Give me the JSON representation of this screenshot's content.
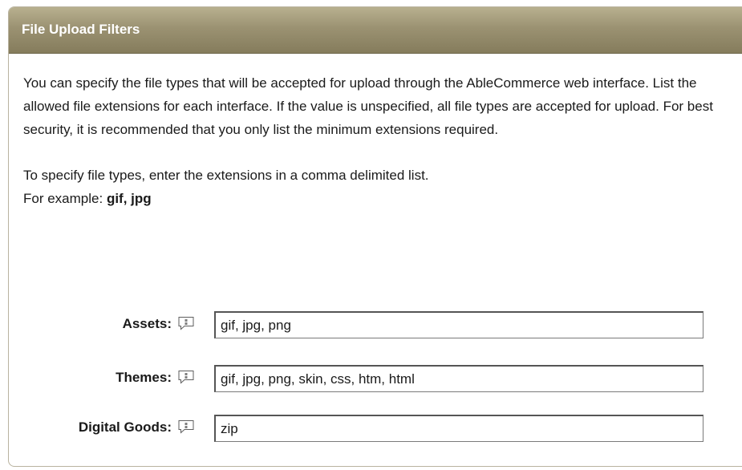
{
  "panel": {
    "title": "File Upload Filters"
  },
  "description": {
    "paragraph1": "You can specify the file types that will be accepted for upload through the AbleCommerce web interface. List the allowed file extensions for each interface. If the value is unspecified, all file types are accepted for upload. For best security, it is recommended that you only list the minimum extensions required.",
    "paragraph2": "To specify file types, enter the extensions in a comma delimited list.",
    "example_prefix": "For example: ",
    "example_value": "gif, jpg"
  },
  "fields": {
    "assets": {
      "label": "Assets:",
      "value": "gif, jpg, png",
      "help_icon": "help-icon"
    },
    "themes": {
      "label": "Themes:",
      "value": "gif, jpg, png, skin, css, htm, html",
      "help_icon": "help-icon"
    },
    "digital_goods": {
      "label": "Digital Goods:",
      "value": "zip",
      "help_icon": "help-icon"
    }
  },
  "colors": {
    "header_gradient_top": "#b8b08f",
    "header_gradient_bottom": "#857c5c",
    "header_text": "#ffffff",
    "panel_border": "#b9b3a0"
  }
}
